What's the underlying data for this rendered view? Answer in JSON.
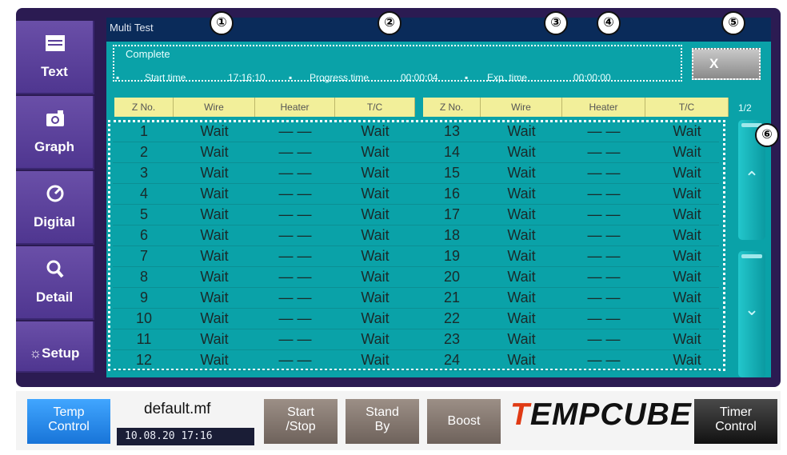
{
  "window": {
    "title": "Multi Test"
  },
  "nav": [
    {
      "label": "Text",
      "icon": "document-icon"
    },
    {
      "label": "Graph",
      "icon": "camera-icon"
    },
    {
      "label": "Digital",
      "icon": "gauge-icon"
    },
    {
      "label": "Detail",
      "icon": "magnifier-icon"
    },
    {
      "label": "Setup",
      "icon": "gear-icon"
    }
  ],
  "status": {
    "message": "Complete",
    "start_label": "Start time",
    "start_value": "17:16:10",
    "progress_label": "Progress time",
    "progress_value": "00:00:04",
    "exp_label": "Exp. time",
    "exp_value": "00:00:00"
  },
  "close_label": "X",
  "headers": [
    "Z No.",
    "Wire",
    "Heater",
    "T/C"
  ],
  "page_indicator": "1/2",
  "rows_left": [
    [
      "1",
      "Wait",
      "— —",
      "Wait"
    ],
    [
      "2",
      "Wait",
      "— —",
      "Wait"
    ],
    [
      "3",
      "Wait",
      "— —",
      "Wait"
    ],
    [
      "4",
      "Wait",
      "— —",
      "Wait"
    ],
    [
      "5",
      "Wait",
      "— —",
      "Wait"
    ],
    [
      "6",
      "Wait",
      "— —",
      "Wait"
    ],
    [
      "7",
      "Wait",
      "— —",
      "Wait"
    ],
    [
      "8",
      "Wait",
      "— —",
      "Wait"
    ],
    [
      "9",
      "Wait",
      "— —",
      "Wait"
    ],
    [
      "10",
      "Wait",
      "— —",
      "Wait"
    ],
    [
      "11",
      "Wait",
      "— —",
      "Wait"
    ],
    [
      "12",
      "Wait",
      "— —",
      "Wait"
    ]
  ],
  "rows_right": [
    [
      "13",
      "Wait",
      "— —",
      "Wait"
    ],
    [
      "14",
      "Wait",
      "— —",
      "Wait"
    ],
    [
      "15",
      "Wait",
      "— —",
      "Wait"
    ],
    [
      "16",
      "Wait",
      "— —",
      "Wait"
    ],
    [
      "17",
      "Wait",
      "— —",
      "Wait"
    ],
    [
      "18",
      "Wait",
      "— —",
      "Wait"
    ],
    [
      "19",
      "Wait",
      "— —",
      "Wait"
    ],
    [
      "20",
      "Wait",
      "— —",
      "Wait"
    ],
    [
      "21",
      "Wait",
      "— —",
      "Wait"
    ],
    [
      "22",
      "Wait",
      "— —",
      "Wait"
    ],
    [
      "23",
      "Wait",
      "— —",
      "Wait"
    ],
    [
      "24",
      "Wait",
      "— —",
      "Wait"
    ]
  ],
  "callouts": [
    "①",
    "②",
    "③",
    "④",
    "⑤",
    "⑥"
  ],
  "bottom": {
    "temp_control": [
      "Temp",
      "Control"
    ],
    "file_name": "default.mf",
    "clock": "10.08.20  17:16",
    "start_stop": [
      "Start",
      "/Stop"
    ],
    "stand_by": [
      "Stand",
      "By"
    ],
    "boost": "Boost",
    "brand_mark": "T",
    "brand_rest": "EMPCUBE",
    "timer_control": [
      "Timer",
      "Control"
    ]
  },
  "colors": {
    "panel": "#0aa2a8",
    "header": "#f2ef9a",
    "nav": "#5a3f99",
    "brand_accent": "#e03a14"
  }
}
